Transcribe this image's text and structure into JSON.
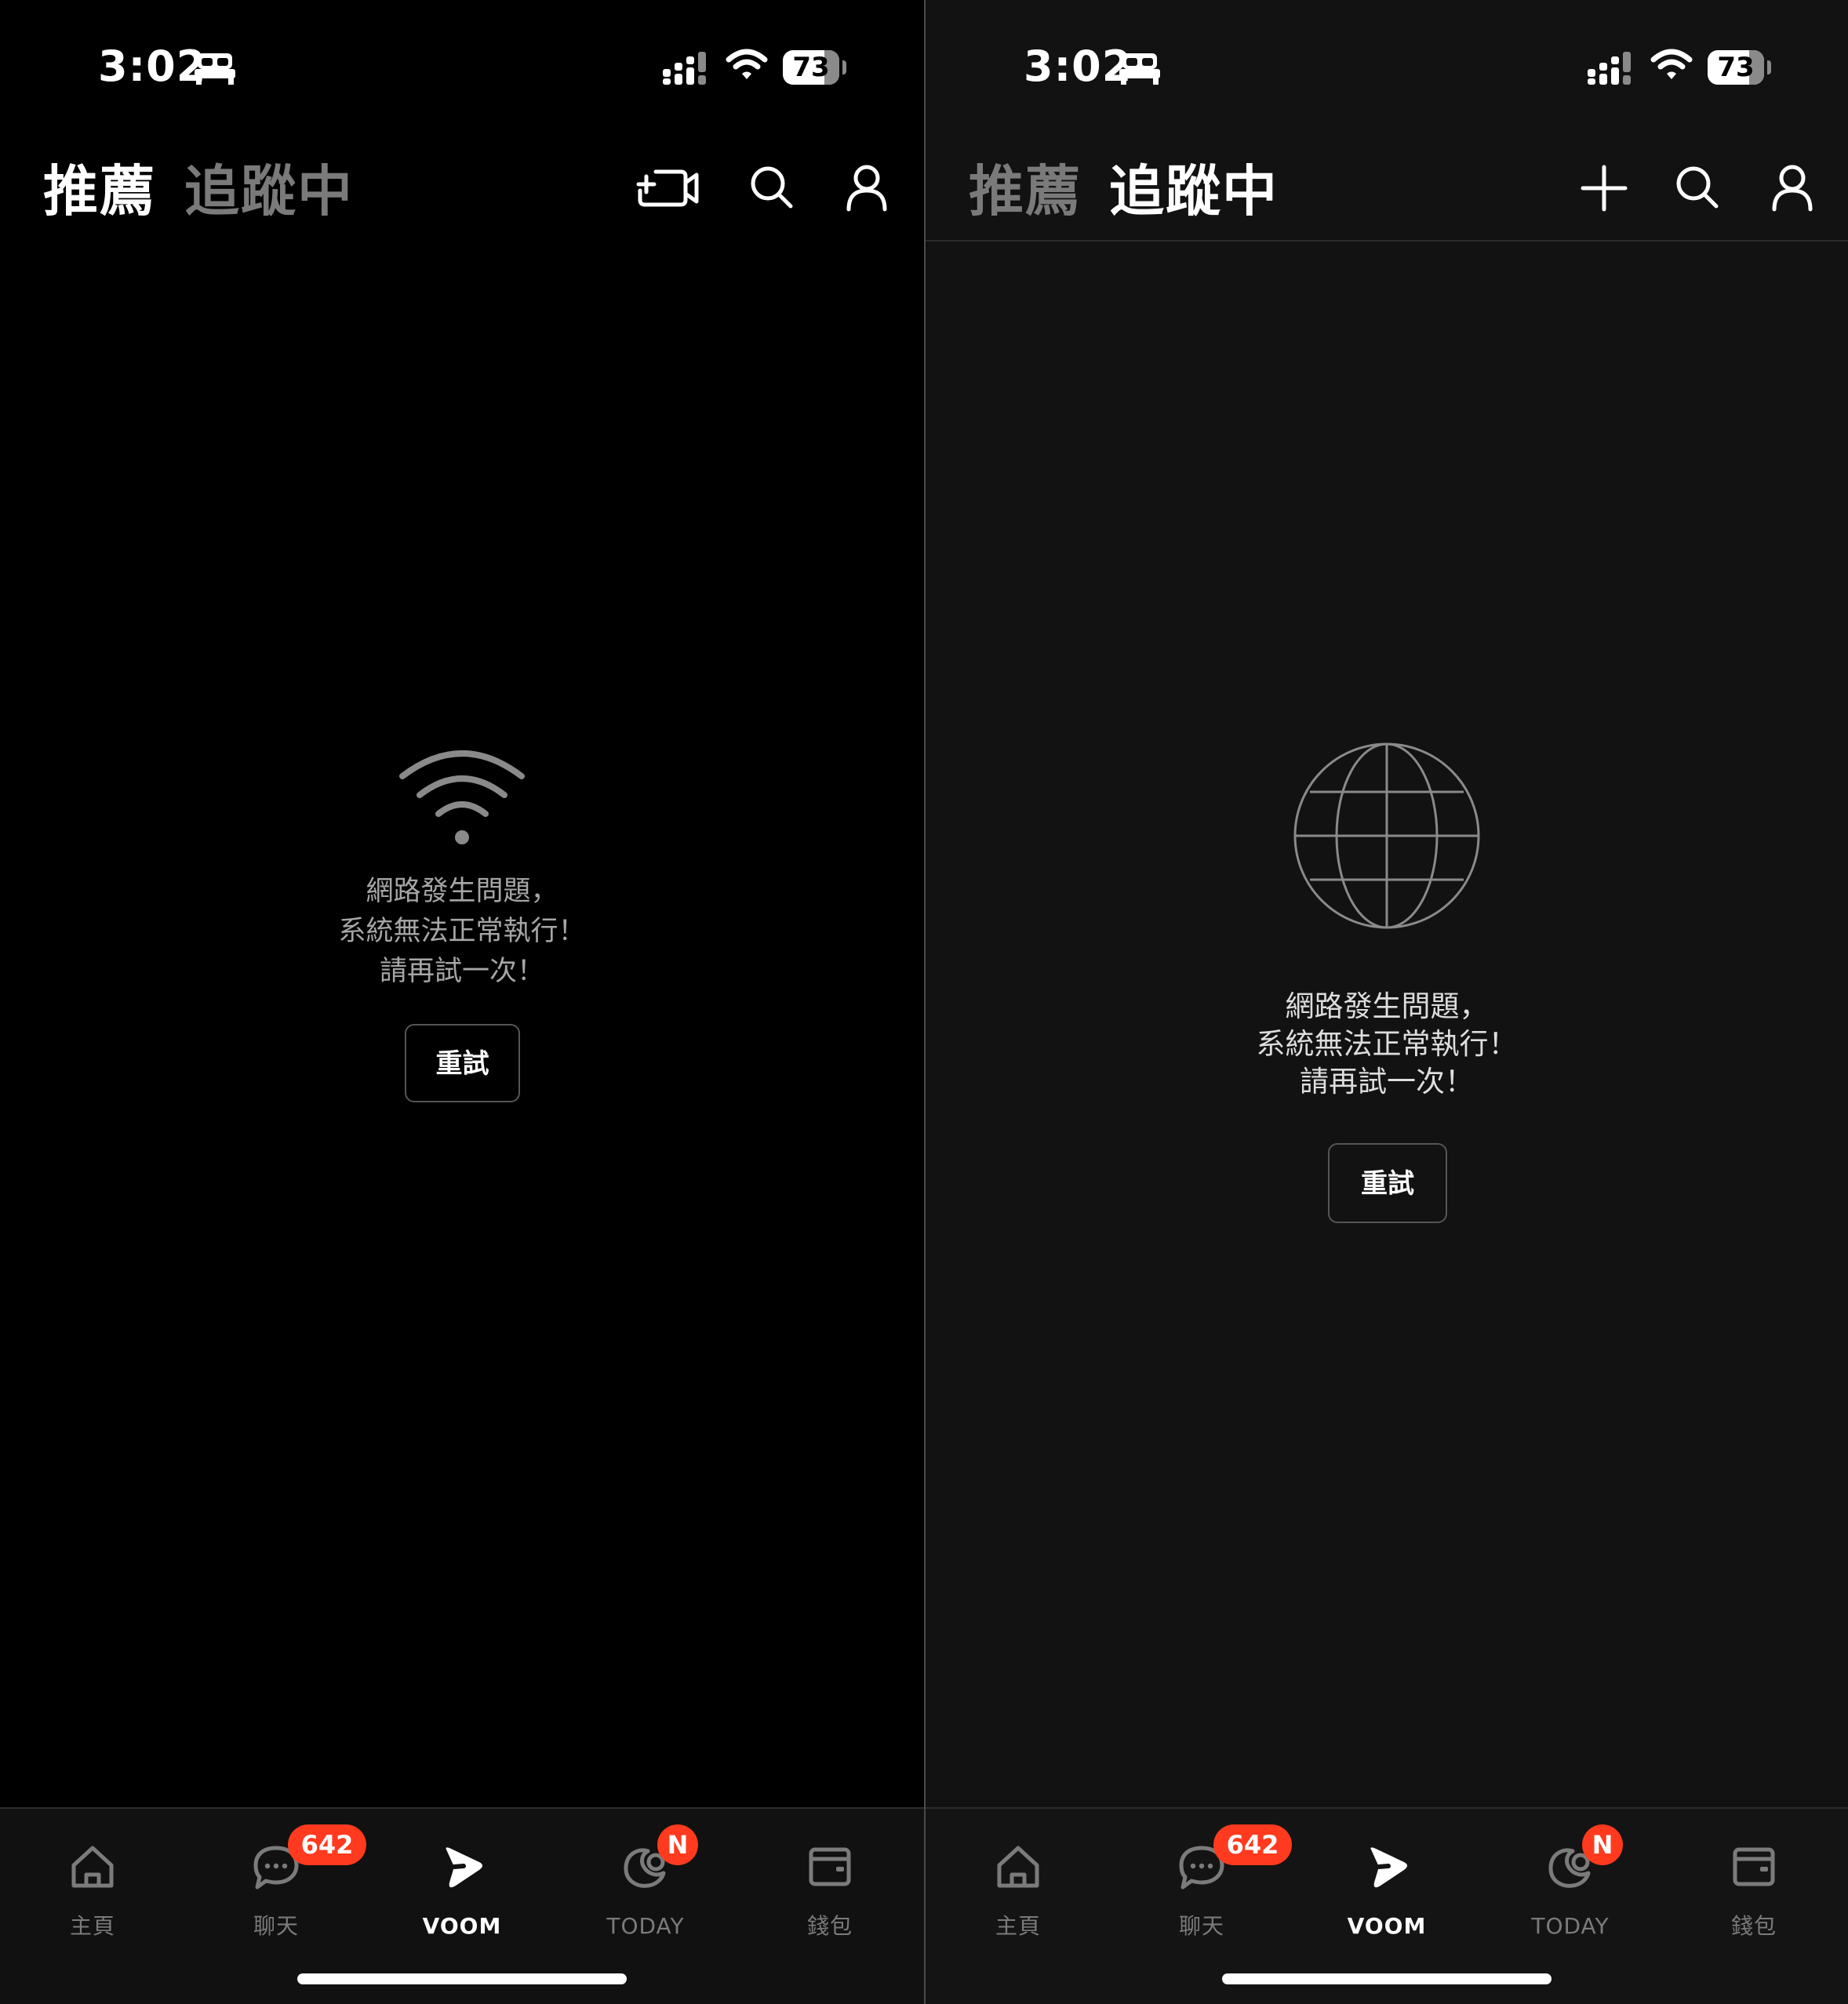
{
  "status_bar": {
    "time": "3:02",
    "battery": "73",
    "battery_level": 0.73
  },
  "left": {
    "tabs": {
      "recommended": "推薦",
      "following": "追蹤中"
    },
    "error": {
      "line1": "網路發生問題，",
      "line2": "系統無法正常執行！",
      "line3": "請再試一次！"
    },
    "retry_label": "重試"
  },
  "right": {
    "tabs": {
      "recommended": "推薦",
      "following": "追蹤中"
    },
    "error": {
      "line1": "網路發生問題，",
      "line2": "系統無法正常執行！",
      "line3": "請再試一次！"
    },
    "retry_label": "重試"
  },
  "tabbar": {
    "items": [
      {
        "label": "主頁",
        "icon": "home-icon"
      },
      {
        "label": "聊天",
        "icon": "chat-icon",
        "badge": "642"
      },
      {
        "label": "VOOM",
        "icon": "voom-icon",
        "active": true
      },
      {
        "label": "TODAY",
        "icon": "today-icon",
        "badge": "N"
      },
      {
        "label": "錢包",
        "icon": "wallet-icon"
      }
    ]
  },
  "colors": {
    "badge": "#ff3a1e",
    "inactive_tab": "#7a7a7a",
    "background_left": "#000000",
    "background_right": "#121212"
  }
}
